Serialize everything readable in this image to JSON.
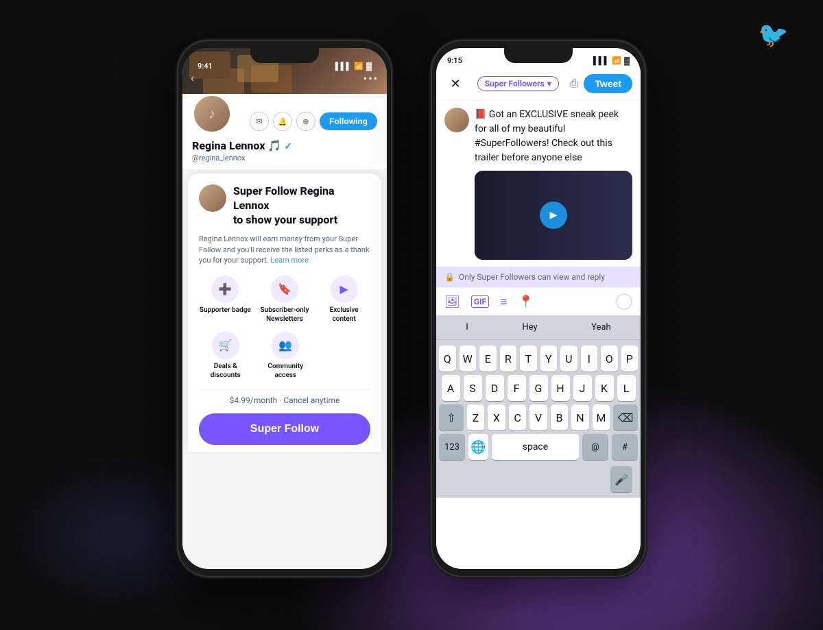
{
  "bg": {
    "color": "#0d0d0d"
  },
  "twitter_logo": "🐦",
  "phone1": {
    "status_time": "9:41",
    "status_signal": "▌▌▌",
    "status_wifi": "WiFi",
    "status_battery": "🔋",
    "nav_back": "‹",
    "nav_more": "•••",
    "profile_name": "Regina Lennox 🎵",
    "profile_handle": "@regina_lennox",
    "following_label": "Following",
    "modal": {
      "title_line1": "Super Follow Regina Lennox",
      "title_line2": "to show your support",
      "description": "Regina Lennox will earn money from your Super Follow and you'll receive the listed perks as a thank you for your support.",
      "learn_more": "Learn more",
      "perks": [
        {
          "icon": "➕",
          "label": "Supporter badge"
        },
        {
          "icon": "🔖",
          "label": "Subscriber-only Newsletters"
        },
        {
          "icon": "▶",
          "label": "Exclusive content"
        }
      ],
      "perks2": [
        {
          "icon": "🛒",
          "label": "Deals & discounts"
        },
        {
          "icon": "👥",
          "label": "Community access"
        }
      ],
      "price": "$4.99/month · Cancel anytime",
      "cta_label": "Super Follow"
    }
  },
  "phone2": {
    "status_time": "9:15",
    "status_signal": "▌▌▌",
    "status_wifi": "WiFi",
    "status_battery": "🔋",
    "close_icon": "✕",
    "edit_icon": "✏",
    "tweet_label": "Tweet",
    "audience": {
      "label": "Super Followers",
      "arrow": "▾"
    },
    "tweet_body": "📕 Got an EXCLUSIVE sneak peek for all of my beautiful #SuperFollowers! Check out this trailer before anyone else",
    "super_followers_bar": "Only Super Followers can view and reply",
    "toolbar_icons": [
      "🖼",
      "GIF",
      "📋",
      "📍"
    ],
    "suggestions": [
      "I",
      "Hey",
      "Yeah"
    ],
    "keyboard_rows": [
      [
        "Q",
        "W",
        "E",
        "R",
        "T",
        "Y",
        "U",
        "I",
        "O",
        "P"
      ],
      [
        "A",
        "S",
        "D",
        "F",
        "G",
        "H",
        "J",
        "K",
        "L"
      ],
      [
        "⇧",
        "Z",
        "X",
        "C",
        "V",
        "B",
        "N",
        "M",
        "⌫"
      ],
      [
        "123",
        "space",
        "@",
        "#"
      ]
    ]
  }
}
